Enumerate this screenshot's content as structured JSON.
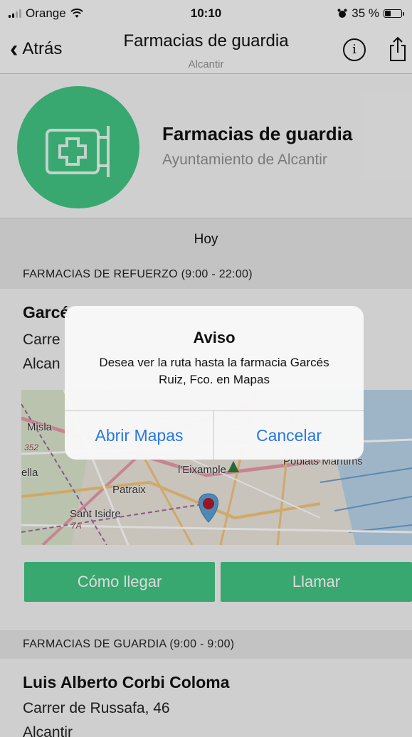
{
  "status_bar": {
    "carrier": "Orange",
    "time": "10:10",
    "battery": "35 %",
    "battery_level": 0.35,
    "signal_bars": 2
  },
  "nav": {
    "back_label": "Atrás",
    "title": "Farmacias de guardia",
    "subtitle": "Alcantir",
    "info_glyph": "i"
  },
  "header": {
    "name": "Farmacias de guardia",
    "organization": "Ayuntamiento de Alcantir",
    "logo_icon": "pharmacy-sign-icon",
    "accent_color": "#43c383"
  },
  "day_tab": "Hoy",
  "sections": [
    {
      "title": "FARMACIAS DE REFUERZO (9:00 - 22:00)",
      "pharmacy": {
        "name": "Garcé",
        "address": "Carre",
        "city": "Alcan"
      },
      "map": {
        "labels": [
          "Misla",
          "352",
          "ella",
          "l'Eixample",
          "Poblats Marítims",
          "Patraix",
          "Sant Isidre",
          "7A"
        ]
      },
      "buttons": {
        "directions": "Cómo llegar",
        "call": "Llamar"
      }
    },
    {
      "title": "FARMACIAS DE GUARDIA (9:00 - 9:00)",
      "pharmacy": {
        "name": "Luis Alberto Corbi Coloma",
        "address": "Carrer de Russafa, 46",
        "city": "Alcantir"
      }
    }
  ],
  "alert": {
    "title": "Aviso",
    "message": "Desea ver la ruta hasta la farmacia Garcés Ruiz, Fco. en Mapas",
    "open_button": "Abrir Mapas",
    "cancel_button": "Cancelar",
    "button_color": "#2878e0"
  }
}
